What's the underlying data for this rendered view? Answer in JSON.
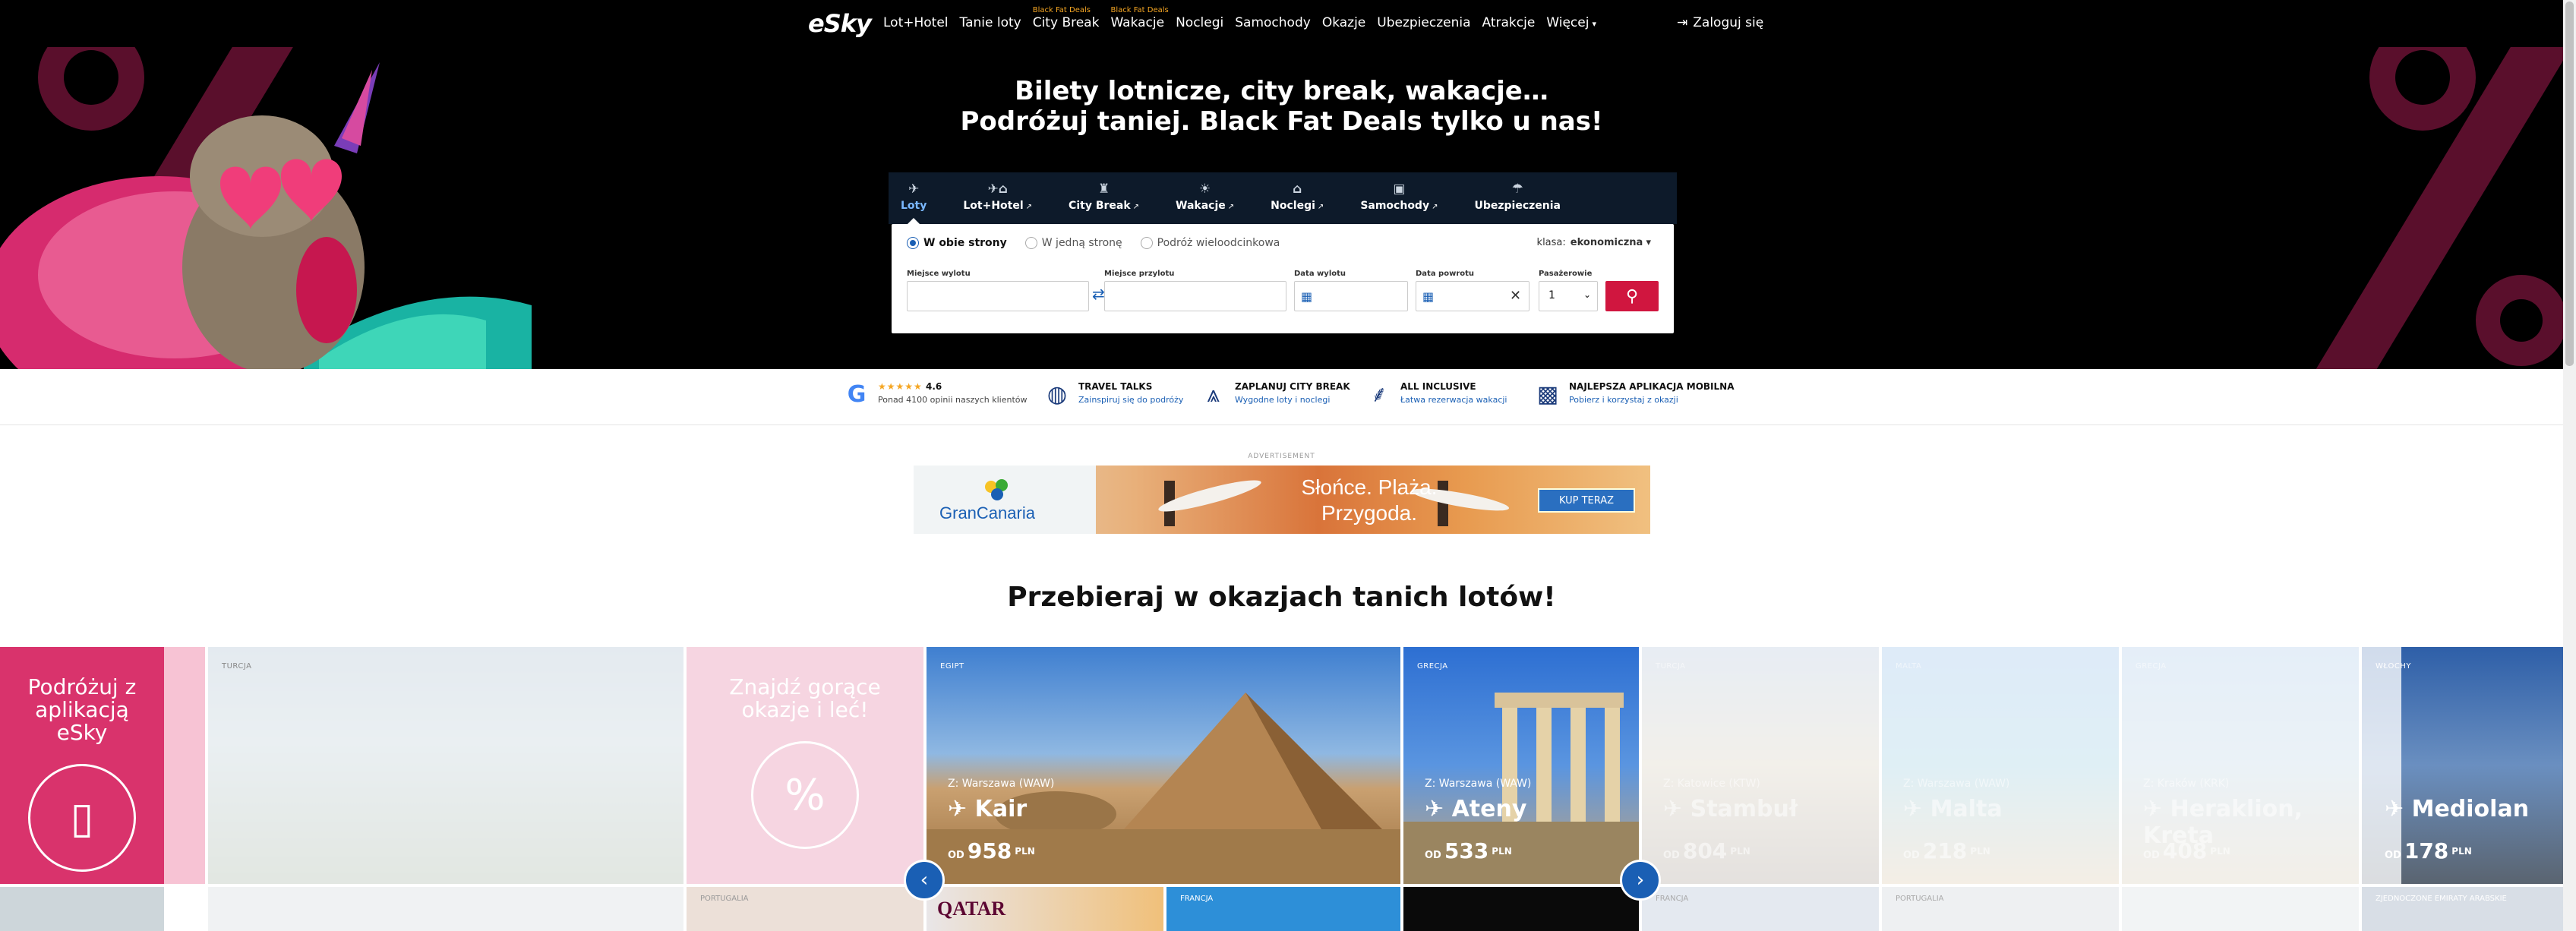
{
  "nav": {
    "logo": "eSky",
    "links": [
      {
        "label": "Lot+Hotel",
        "badge": ""
      },
      {
        "label": "Tanie loty",
        "badge": ""
      },
      {
        "label": "City Break",
        "badge": "Black Fat Deals"
      },
      {
        "label": "Wakacje",
        "badge": "Black Fat Deals"
      },
      {
        "label": "Noclegi",
        "badge": ""
      },
      {
        "label": "Samochody",
        "badge": ""
      },
      {
        "label": "Okazje",
        "badge": ""
      },
      {
        "label": "Ubezpieczenia",
        "badge": ""
      },
      {
        "label": "Atrakcje",
        "badge": ""
      },
      {
        "label": "Więcej",
        "badge": ""
      }
    ],
    "login": "Zaloguj się"
  },
  "hero": {
    "title_line1": "Bilety lotnicze, city break, wakacje…",
    "title_line2": "Podróżuj taniej. Black Fat Deals tylko u nas!"
  },
  "search": {
    "tabs": [
      {
        "label": "Loty",
        "icon": "plane-icon",
        "active": true
      },
      {
        "label": "Lot+Hotel",
        "icon": "plane-hotel-icon",
        "active": false
      },
      {
        "label": "City Break",
        "icon": "city-icon",
        "active": false
      },
      {
        "label": "Wakacje",
        "icon": "beach-icon",
        "active": false
      },
      {
        "label": "Noclegi",
        "icon": "bed-icon",
        "active": false
      },
      {
        "label": "Samochody",
        "icon": "car-icon",
        "active": false
      },
      {
        "label": "Ubezpieczenia",
        "icon": "umbrella-icon",
        "active": false
      }
    ],
    "trip_types": [
      "W obie strony",
      "W jedną stronę",
      "Podróż wieloodcinkowa"
    ],
    "class_label": "klasa:",
    "class_value": "ekonomiczna",
    "departure_label": "Miejsce wylotu",
    "arrival_label": "Miejsce przylotu",
    "depart_date_label": "Data wylotu",
    "return_date_label": "Data powrotu",
    "passengers_label": "Pasażerowie",
    "passengers_value": "1"
  },
  "trust": [
    {
      "title": "4.6",
      "sub": "Ponad 4100 opinii naszych klientów",
      "icon": "google-icon"
    },
    {
      "title": "TRAVEL TALKS",
      "sub": "Zainspiruj się do podróży",
      "icon": "globe-icon"
    },
    {
      "title": "ZAPLANUJ CITY BREAK",
      "sub": "Wygodne loty i noclegi",
      "icon": "eiffel-icon"
    },
    {
      "title": "ALL INCLUSIVE",
      "sub": "Łatwa rezerwacja wakacji",
      "icon": "palm-icon"
    },
    {
      "title": "NAJLEPSZA APLIKACJA MOBILNA",
      "sub": "Pobierz i korzystaj z okazji",
      "icon": "qr-icon"
    }
  ],
  "ad": {
    "label": "ADVERTISEMENT",
    "brand": "GranCanaria",
    "headline_1": "Słońce. Plaża.",
    "headline_2": "Przygoda.",
    "cta": "KUP TERAZ"
  },
  "deals": {
    "title": "Przebieraj w okazjach tanich lotów!",
    "promo_app": "Podróżuj z aplikacją eSky",
    "promo_hot": "Znajdź gorące okazje i leć!",
    "price_prefix": "OD",
    "currency": "PLN",
    "cards": [
      {
        "country": "TURCJA",
        "from": "",
        "city": "",
        "price": ""
      },
      {
        "country": "EGIPT",
        "from": "Z: Warszawa (WAW)",
        "city": "Kair",
        "price": "958"
      },
      {
        "country": "GRECJA",
        "from": "Z: Warszawa (WAW)",
        "city": "Ateny",
        "price": "533"
      },
      {
        "country": "TURCJA",
        "from": "Z: Katowice (KTW)",
        "city": "Stambuł",
        "price": "804"
      },
      {
        "country": "MALTA",
        "from": "Z: Warszawa (WAW)",
        "city": "Malta",
        "price": "218"
      },
      {
        "country": "GRECJA",
        "from": "Z: Kraków (KRK)",
        "city": "Heraklion, Kreta",
        "price": "408"
      },
      {
        "country": "WŁOCHY",
        "from": "",
        "city": "Mediolan",
        "price": "178"
      }
    ],
    "row2": [
      "PORTUGALIA",
      "FRANCJA",
      "FRANCJA",
      "PORTUGALIA",
      "ZJEDNOCZONE EMIRATY ARABSKIE"
    ],
    "qatar": "QATAR"
  }
}
